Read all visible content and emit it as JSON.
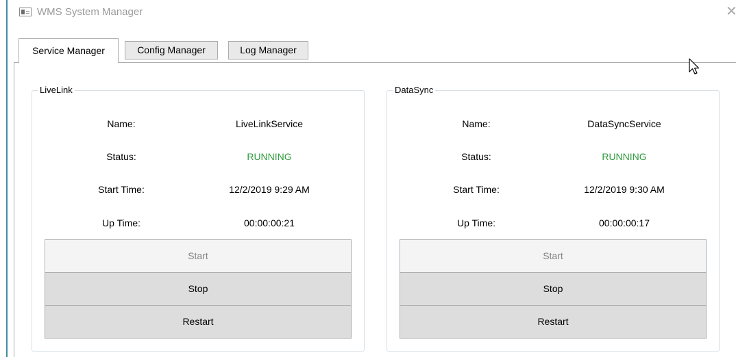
{
  "window": {
    "title": "WMS System Manager",
    "close_glyph": "✕"
  },
  "tabs": [
    {
      "label": "Service Manager",
      "active": true
    },
    {
      "label": "Config Manager",
      "active": false
    },
    {
      "label": "Log Manager",
      "active": false
    }
  ],
  "services": [
    {
      "group_title": "LiveLink",
      "name_label": "Name:",
      "name_value": "LiveLinkService",
      "status_label": "Status:",
      "status_value": "RUNNING",
      "start_time_label": "Start Time:",
      "start_time_value": "12/2/2019 9:29 AM",
      "up_time_label": "Up Time:",
      "up_time_value": "00:00:00:21",
      "start_button": "Start",
      "stop_button": "Stop",
      "restart_button": "Restart"
    },
    {
      "group_title": "DataSync",
      "name_label": "Name:",
      "name_value": "DataSyncService",
      "status_label": "Status:",
      "status_value": "RUNNING",
      "start_time_label": "Start Time:",
      "start_time_value": "12/2/2019 9:30 AM",
      "up_time_label": "Up Time:",
      "up_time_value": "00:00:00:17",
      "start_button": "Start",
      "stop_button": "Stop",
      "restart_button": "Restart"
    }
  ],
  "colors": {
    "status_running": "#2e9b3c",
    "window_accent": "#3c8ca0"
  },
  "icons": {
    "app": "app-window-icon",
    "close": "close-icon",
    "cursor": "mouse-pointer-icon"
  }
}
